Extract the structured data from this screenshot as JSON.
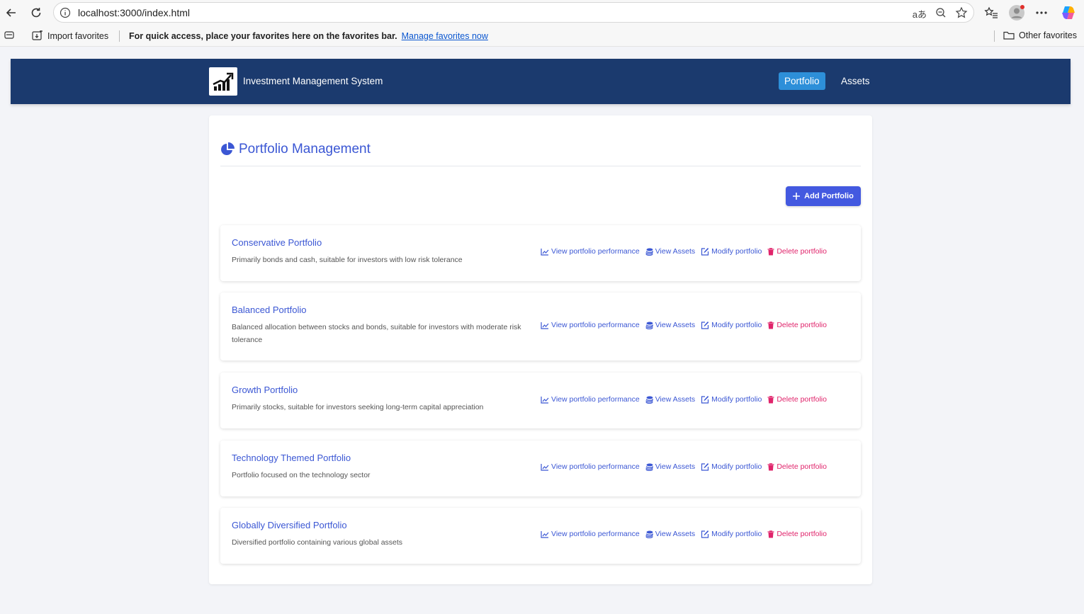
{
  "browser": {
    "url": "localhost:3000/index.html",
    "read_aloud": "aあ"
  },
  "favorites_bar": {
    "import_label": "Import favorites",
    "message": "For quick access, place your favorites here on the favorites bar.",
    "manage_link": "Manage favorites now",
    "other_label": "Other favorites"
  },
  "header": {
    "title": "Investment Management System",
    "nav": [
      {
        "label": "Portfolio",
        "active": true
      },
      {
        "label": "Assets",
        "active": false
      }
    ]
  },
  "main": {
    "title": "Portfolio Management",
    "add_button": "Add Portfolio",
    "actions": {
      "performance": "View portfolio performance",
      "assets": "View Assets",
      "modify": "Modify portfolio",
      "delete": "Delete portfolio"
    },
    "portfolios": [
      {
        "name": "Conservative Portfolio",
        "description": "Primarily bonds and cash, suitable for investors with low risk tolerance"
      },
      {
        "name": "Balanced Portfolio",
        "description": "Balanced allocation between stocks and bonds, suitable for investors with moderate risk tolerance"
      },
      {
        "name": "Growth Portfolio",
        "description": "Primarily stocks, suitable for investors seeking long-term capital appreciation"
      },
      {
        "name": "Technology Themed Portfolio",
        "description": "Portfolio focused on the technology sector"
      },
      {
        "name": "Globally Diversified Portfolio",
        "description": "Diversified portfolio containing various global assets"
      }
    ]
  },
  "colors": {
    "header_bg": "#1b3a6e",
    "nav_active": "#2d8fd9",
    "accent": "#3b57d4",
    "button": "#4359e0",
    "danger": "#e0246b"
  }
}
